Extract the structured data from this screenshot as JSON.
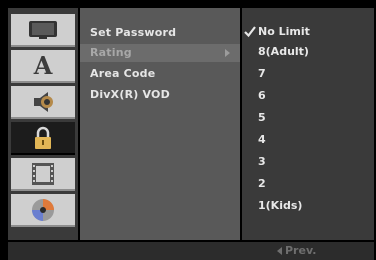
{
  "sidebar": {
    "icons": [
      {
        "name": "tv-icon"
      },
      {
        "name": "language-icon",
        "glyph": "A"
      },
      {
        "name": "audio-icon"
      },
      {
        "name": "lock-icon",
        "active": true
      },
      {
        "name": "film-icon"
      },
      {
        "name": "disc-icon"
      }
    ]
  },
  "menu": {
    "items": [
      {
        "label": "Set Password"
      },
      {
        "label": "Rating",
        "highlighted": true
      },
      {
        "label": "Area Code"
      },
      {
        "label": "DivX(R) VOD"
      }
    ]
  },
  "options": {
    "selected": "No Limit",
    "items": [
      {
        "label": "No Limit",
        "checked": true
      },
      {
        "label": "8(Adult)"
      },
      {
        "label": "7"
      },
      {
        "label": "6"
      },
      {
        "label": "5"
      },
      {
        "label": "4"
      },
      {
        "label": "3"
      },
      {
        "label": "2"
      },
      {
        "label": "1(Kids)"
      }
    ]
  },
  "footer": {
    "prev_label": "Prev."
  },
  "colors": {
    "background": "#000000",
    "panel": "#595959",
    "sidebar": "#3a3a3a",
    "text": "#e6e6e6"
  }
}
